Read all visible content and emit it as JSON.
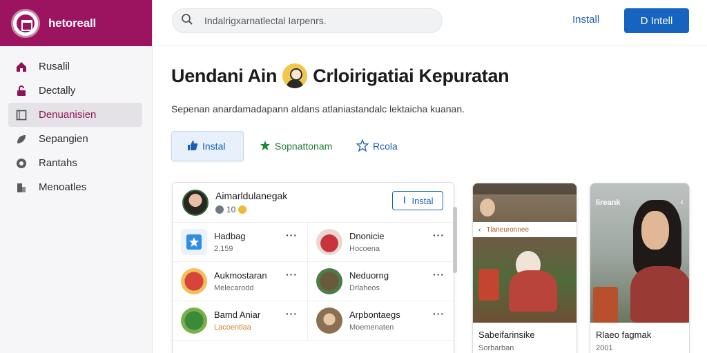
{
  "brand": {
    "name": "hetoreall"
  },
  "sidebar": {
    "items": [
      {
        "label": "Rusalil",
        "icon": "home-icon",
        "active": false
      },
      {
        "label": "Dectally",
        "icon": "lock-icon",
        "active": false
      },
      {
        "label": "Denuanisien",
        "icon": "square-icon",
        "active": true
      },
      {
        "label": "Sepangien",
        "icon": "leaf-icon",
        "active": false
      },
      {
        "label": "Rantahs",
        "icon": "circle-icon",
        "active": false
      },
      {
        "label": "Menoatles",
        "icon": "building-icon",
        "active": false
      }
    ]
  },
  "topbar": {
    "search_placeholder": "Indalrigxarnatlectal Iarpenrs.",
    "link_label": "Install",
    "button_label": "D Intell"
  },
  "page": {
    "title_left": "Uendani Ain",
    "title_right": "Crloirigatiai Kepuratan",
    "subtitle": "Sepenan anardamadapann aldans atlaniastandalc lektaicha kuanan."
  },
  "tabs": [
    {
      "label": "Instal",
      "icon": "thumbs-up-icon"
    },
    {
      "label": "Sopnattonam",
      "icon": "star-filled-icon"
    },
    {
      "label": "Rcola",
      "icon": "star-outline-icon"
    }
  ],
  "card": {
    "name": "Aimarldulanegak",
    "meta": "10",
    "button_label": "Instal",
    "items": [
      {
        "title": "Hadbag",
        "sub": "2,159",
        "color": "#2e8ee0"
      },
      {
        "title": "Dnonicie",
        "sub": "Hocoena",
        "color": "#c9343c"
      },
      {
        "title": "Aukmostaran",
        "sub": "Melecarodd",
        "color": "#d8443a"
      },
      {
        "title": "Neduorng",
        "sub": "Drlaheos",
        "color": "#6a5a3c"
      },
      {
        "title": "Bamd Aniar",
        "sub": "Lacoentlaa",
        "color": "#3a8a3a"
      },
      {
        "title": "Arpbontaegs",
        "sub": "Moemenaten",
        "color": "#8a7050"
      }
    ]
  },
  "phones": [
    {
      "title": "Sabeifarinsike",
      "sub": "Sorbarban",
      "status": "",
      "bar": "Tlaneuronnee"
    },
    {
      "title": "Rlaeo fagmak",
      "sub": "2001",
      "caption": "lireank"
    }
  ],
  "colors": {
    "brand": "#9c135f",
    "accent": "#1764c0",
    "green": "#1f7a3a"
  }
}
